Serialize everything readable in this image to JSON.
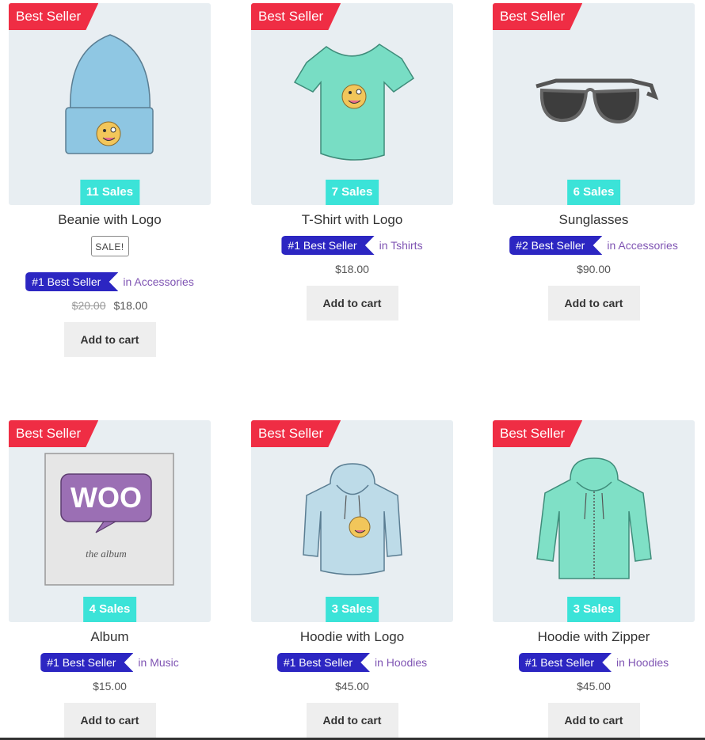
{
  "products": [
    {
      "ribbon": "Best Seller",
      "sales": "11 Sales",
      "title": "Beanie with Logo",
      "sale_badge": "SALE!",
      "rank": "#1 Best Seller",
      "category": "in Accessories",
      "old_price": "$20.00",
      "price": "$18.00",
      "cart": "Add to cart"
    },
    {
      "ribbon": "Best Seller",
      "sales": "7 Sales",
      "title": "T-Shirt with Logo",
      "rank": "#1 Best Seller",
      "category": "in Tshirts",
      "price": "$18.00",
      "cart": "Add to cart"
    },
    {
      "ribbon": "Best Seller",
      "sales": "6 Sales",
      "title": "Sunglasses",
      "rank": "#2 Best Seller",
      "category": "in Accessories",
      "price": "$90.00",
      "cart": "Add to cart"
    },
    {
      "ribbon": "Best Seller",
      "sales": "4 Sales",
      "title": "Album",
      "rank": "#1 Best Seller",
      "category": "in Music",
      "price": "$15.00",
      "cart": "Add to cart",
      "album_logo": "WOO",
      "album_subtitle": "the album"
    },
    {
      "ribbon": "Best Seller",
      "sales": "3 Sales",
      "title": "Hoodie with Logo",
      "rank": "#1 Best Seller",
      "category": "in Hoodies",
      "price": "$45.00",
      "cart": "Add to cart"
    },
    {
      "ribbon": "Best Seller",
      "sales": "3 Sales",
      "title": "Hoodie with Zipper",
      "rank": "#1 Best Seller",
      "category": "in Hoodies",
      "price": "$45.00",
      "cart": "Add to cart"
    }
  ],
  "colors": {
    "ribbon": "#ef2d44",
    "sales_badge": "#3be3d8",
    "rank_badge": "#2c26c2",
    "category_link": "#7f54b3",
    "image_bg": "#e8eef2",
    "cart_button": "#eeeeee"
  }
}
